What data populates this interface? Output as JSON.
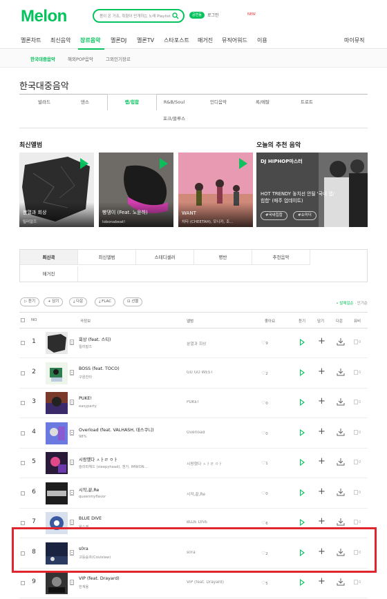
{
  "header": {
    "logo": "Melon",
    "search_placeholder": "봄이 온 거죠, 취향이 만개하는 노래 Playlist",
    "pill": "공연동",
    "user": "로그인",
    "alarm": "NEW"
  },
  "gnb": [
    "멜론차트",
    "최신음악",
    "장르음악",
    "멜론DJ",
    "멜론TV",
    "스타포스트",
    "매거진",
    "뮤직어워드",
    "이용"
  ],
  "gnb_right": "마이뮤직",
  "subnav": [
    "한국대중음악",
    "해외POP음악",
    "그외인기장르"
  ],
  "page_title": "한국대중음악",
  "genres": [
    "발라드",
    "댄스",
    "랩/힙합",
    "R&B/Soul",
    "인디음악",
    "록/메탈",
    "트로트",
    "포크/블루스"
  ],
  "sections": {
    "latest": "최신앨범",
    "recommend": "오늘의 추천 음악"
  },
  "albums": [
    {
      "title": "분열과 회상",
      "artist": "릴러말즈"
    },
    {
      "title": "빵댕이 (Feat. 노윤하)",
      "artist": "lobonabeat!"
    },
    {
      "title": "WANT",
      "artist": "치타 (CHEETAH), 모니카, 조..."
    }
  ],
  "recommend": {
    "dj": "DJ HIPHOP마스터",
    "title": "HOT TRENDY 놓치선 안될 '국내 랩/힙합' (매주 업데이트)",
    "tags": [
      "#국내힙합",
      "#쇼미더"
    ]
  },
  "tabs": [
    "최신곡",
    "최신앨범",
    "스테디셀러",
    "명반",
    "추천음악",
    "매거진"
  ],
  "controls": [
    "▷ 듣기",
    "+ 담기",
    "⤓ 다운",
    "⤓ FLAC",
    "⊡ 선물"
  ],
  "order": {
    "active": "• 발매일순",
    "other": "· 인기순"
  },
  "columns": [
    "NO",
    "곡정보",
    "앨범",
    "좋아요",
    "듣기",
    "담기",
    "다운",
    "뮤비"
  ],
  "rows": [
    {
      "no": "1",
      "song": "회상 (feat. 스티)",
      "artist": "릴러말즈",
      "album": "분열과 회상",
      "likes": "9"
    },
    {
      "no": "2",
      "song": "BOSS (feat. TOCO)",
      "artist": "구원찬타",
      "album": "GU GO WEST",
      "likes": "2"
    },
    {
      "no": "3",
      "song": "PUKE!",
      "artist": "easyparty",
      "album": "PUKE!",
      "likes": "0"
    },
    {
      "no": "4",
      "song": "Overload (feat. VALHASH, 데스쿠니)",
      "artist": "98%",
      "album": "Overload",
      "likes": "0"
    },
    {
      "no": "5",
      "song": "시랑했다 ㅅㅏㄹ ㅇㅏ",
      "artist": "슬리피헤드 (sleepyhead), 젠가, IMWON...",
      "album": "시랑했다 ㅅㅏㄹ ㅇㅏ",
      "likes": "1"
    },
    {
      "no": "6",
      "song": "시작,끝,Re",
      "artist": "queenmyflavor",
      "album": "시작,끝,Re",
      "likes": "0"
    },
    {
      "no": "7",
      "song": "BLUE DIVE",
      "artist": "왕스케",
      "album": "BLUE DIVE",
      "likes": "6"
    },
    {
      "no": "8",
      "song": "s0ra",
      "artist": "고등승흐(Coulslaw)",
      "album": "s0ra",
      "likes": "2"
    },
    {
      "no": "9",
      "song": "VIP (feat. Drayard)",
      "artist": "한계용",
      "album": "VIP (feat. Drayard)",
      "likes": "5"
    }
  ],
  "highlight_color": "#e0252f",
  "accent": "#04c35c"
}
